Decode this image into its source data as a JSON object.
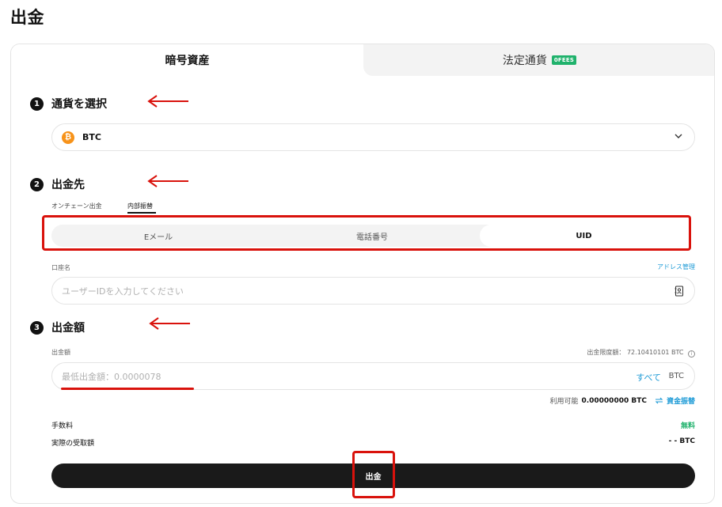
{
  "page": {
    "title": "出金"
  },
  "tabs": {
    "crypto": "暗号資産",
    "fiat": "法定通貨",
    "fiat_badge": "0FEES"
  },
  "steps": [
    {
      "num": "1",
      "label": "通貨を選択"
    },
    {
      "num": "2",
      "label": "出金先"
    },
    {
      "num": "3",
      "label": "出金額"
    }
  ],
  "currency": {
    "selected": "BTC",
    "icon": "bitcoin-icon"
  },
  "destination": {
    "subtabs": [
      "オンチェーン出金",
      "内部振替"
    ],
    "active_subtab": "内部振替",
    "methods": [
      "Eメール",
      "電話番号",
      "UID"
    ],
    "active_method": "UID",
    "account_label": "口座名",
    "address_book": "アドレス管理",
    "uid_placeholder": "ユーザーIDを入力してください"
  },
  "amount": {
    "label": "出金額",
    "limit_label": "出金限度額：",
    "limit_value": "72.10410101 BTC",
    "placeholder": "最低出金額：0.0000078",
    "all": "すべて",
    "unit": "BTC",
    "available_label": "利用可能",
    "available_value": "0.00000000 BTC",
    "transfer": "資金振替"
  },
  "summary": {
    "fee_label": "手数料",
    "fee_value": "無料",
    "received_label": "実際の受取額",
    "received_value": "- - BTC"
  },
  "submit_label": "出金",
  "colors": {
    "accent": "#1c9ad6",
    "green": "#20b26c",
    "annotation": "#d9120c"
  }
}
